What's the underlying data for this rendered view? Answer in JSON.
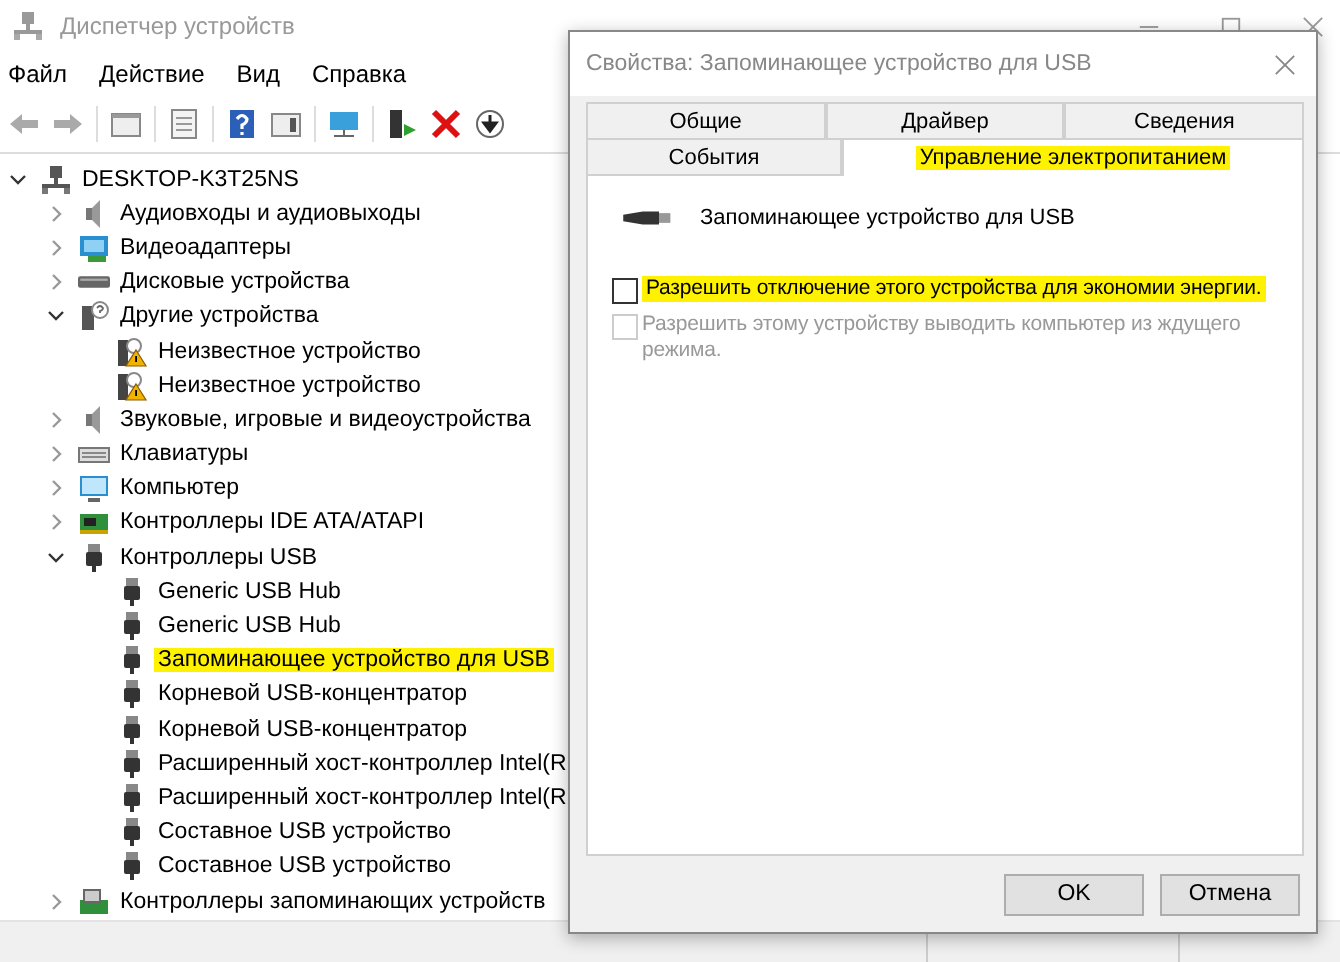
{
  "main_window": {
    "title": "Диспетчер устройств",
    "menu": [
      "Файл",
      "Действие",
      "Вид",
      "Справка"
    ]
  },
  "tree": [
    {
      "label": "DESKTOP-K3T25NS",
      "kind": "computer-root",
      "expanded": true,
      "selected": false,
      "children": [
        {
          "label": "Аудиовходы и аудиовыходы",
          "kind": "audio",
          "expanded": false,
          "selected": false
        },
        {
          "label": "Видеоадаптеры",
          "kind": "display",
          "expanded": false,
          "selected": false
        },
        {
          "label": "Дисковые устройства",
          "kind": "disk",
          "expanded": false,
          "selected": false
        },
        {
          "label": "Другие устройства",
          "kind": "unknown",
          "expanded": true,
          "selected": false,
          "children": [
            {
              "label": "Неизвестное устройство",
              "kind": "warning",
              "selected": false
            },
            {
              "label": "Неизвестное устройство",
              "kind": "warning",
              "selected": false
            }
          ]
        },
        {
          "label": "Звуковые, игровые и видеоустройства",
          "kind": "audio",
          "expanded": false,
          "selected": false
        },
        {
          "label": "Клавиатуры",
          "kind": "keyboard",
          "expanded": false,
          "selected": false
        },
        {
          "label": "Компьютер",
          "kind": "monitor",
          "expanded": false,
          "selected": false
        },
        {
          "label": "Контроллеры IDE ATA/ATAPI",
          "kind": "ide",
          "expanded": false,
          "selected": false
        },
        {
          "label": "Контроллеры USB",
          "kind": "usb",
          "expanded": true,
          "selected": false,
          "children": [
            {
              "label": "Generic USB Hub",
              "kind": "usb",
              "selected": false
            },
            {
              "label": "Generic USB Hub",
              "kind": "usb",
              "selected": false
            },
            {
              "label": "Запоминающее устройство для USB",
              "kind": "usb",
              "selected": true
            },
            {
              "label": "Корневой USB-концентратор",
              "kind": "usb",
              "selected": false
            },
            {
              "label": "Корневой USB-концентратор",
              "kind": "usb",
              "selected": false
            },
            {
              "label": "Расширенный хост-контроллер Intel(R",
              "kind": "usb",
              "selected": false
            },
            {
              "label": "Расширенный хост-контроллер Intel(R",
              "kind": "usb",
              "selected": false
            },
            {
              "label": "Составное USB устройство",
              "kind": "usb",
              "selected": false
            },
            {
              "label": "Составное USB устройство",
              "kind": "usb",
              "selected": false
            }
          ]
        },
        {
          "label": "Контроллеры запоминающих устройств",
          "kind": "storage",
          "expanded": false,
          "selected": false
        }
      ]
    }
  ],
  "dialog": {
    "title": "Свойства: Запоминающее устройство для USB",
    "tab_rows": [
      [
        {
          "label": "Общие",
          "selected": false,
          "highlighted": false
        },
        {
          "label": "Драйвер",
          "selected": false,
          "highlighted": false
        },
        {
          "label": "Сведения",
          "selected": false,
          "highlighted": false
        }
      ],
      [
        {
          "label": "События",
          "selected": false,
          "highlighted": false
        },
        {
          "label": "Управление электропитанием",
          "selected": true,
          "highlighted": true
        }
      ]
    ],
    "device_name": "Запоминающее устройство для USB",
    "options": [
      {
        "label": "Разрешить отключение этого устройства для экономии энергии.",
        "checked": false,
        "disabled": false,
        "highlighted": true
      },
      {
        "label": "Разрешить этому устройству выводить компьютер из ждущего режима.",
        "checked": false,
        "disabled": true,
        "highlighted": false
      }
    ],
    "buttons": [
      "OK",
      "Отмена"
    ]
  }
}
